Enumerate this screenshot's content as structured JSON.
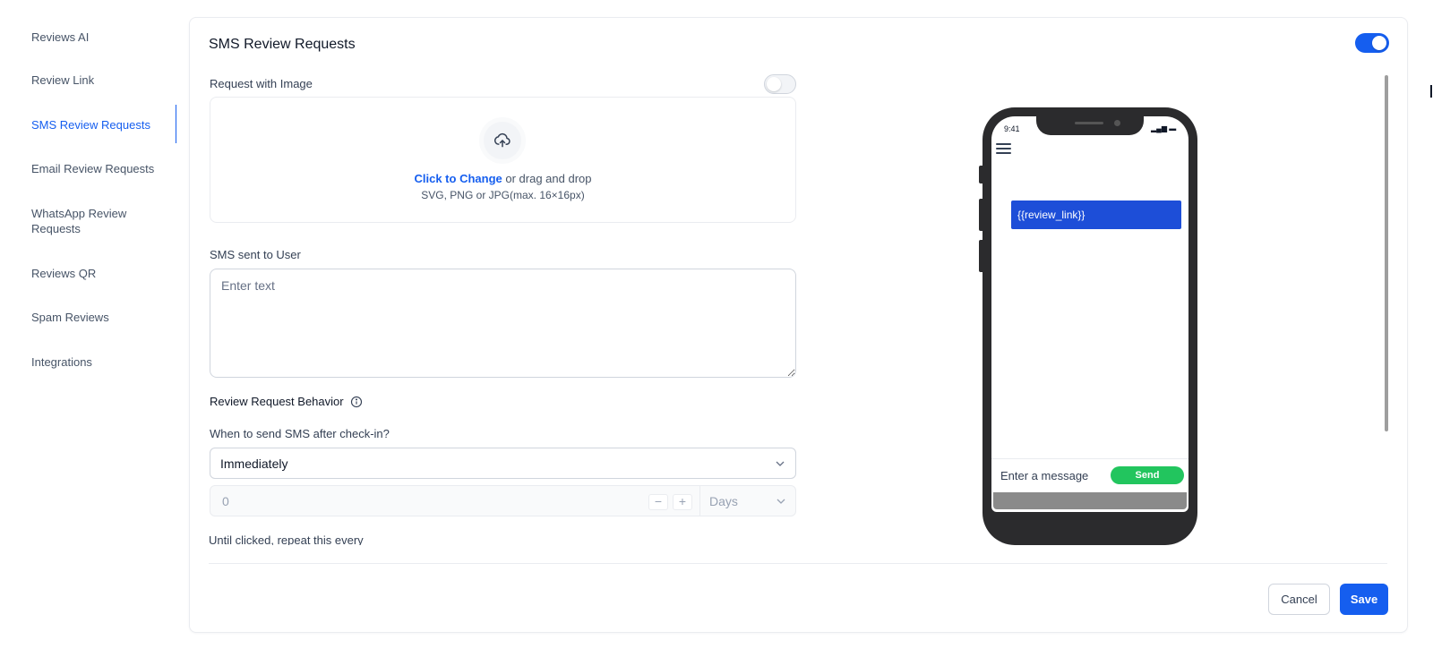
{
  "sidebar": {
    "items": [
      {
        "label": "Reviews AI"
      },
      {
        "label": "Review Link"
      },
      {
        "label": "SMS Review Requests",
        "active": true
      },
      {
        "label": "Email Review Requests"
      },
      {
        "label": "WhatsApp Review Requests"
      },
      {
        "label": "Reviews QR"
      },
      {
        "label": "Spam Reviews"
      },
      {
        "label": "Integrations"
      }
    ]
  },
  "card": {
    "title": "SMS Review Requests",
    "enabled": true
  },
  "image_request": {
    "label": "Request with Image",
    "enabled": false,
    "upload_link": "Click to Change",
    "upload_text": " or drag and drop",
    "upload_hint": "SVG, PNG or JPG(max. 16×16px)"
  },
  "sms": {
    "label": "SMS sent to User",
    "placeholder": "Enter text",
    "value": ""
  },
  "behavior": {
    "title": "Review Request Behavior",
    "when_label": "When to send SMS after check-in?",
    "when_value": "Immediately",
    "delay_value": "0",
    "delay_unit": "Days",
    "repeat_label": "Until clicked, repeat this every"
  },
  "actions": {
    "cancel": "Cancel",
    "save": "Save"
  },
  "phone": {
    "time": "9:41",
    "status": "▂▄▆ ▬",
    "message": "{{review_link}}",
    "input_placeholder": "Enter a message",
    "send": "Send"
  },
  "colors": {
    "accent": "#155eef",
    "send": "#22c55e",
    "bubble": "#1d4ed8"
  }
}
